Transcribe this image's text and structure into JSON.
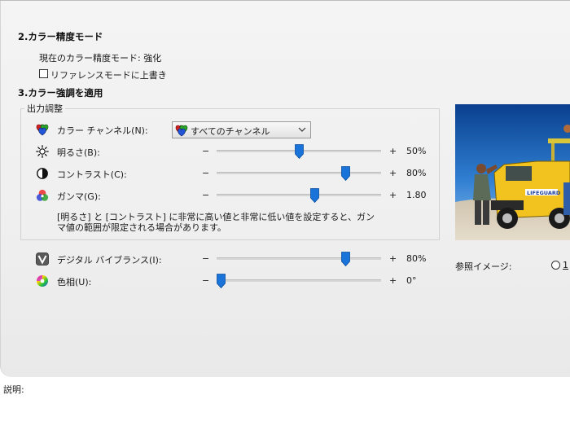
{
  "section2": {
    "heading": "2.カラー精度モード",
    "current_mode_label": "現在のカラー精度モード:",
    "current_mode_value": "強化",
    "override_checkbox_label": "リファレンスモードに上書き",
    "override_checked": false
  },
  "section3": {
    "heading": "3.カラー強調を適用",
    "group_title": "出力調整",
    "channel": {
      "label": "カラー チャンネル(N):",
      "selected": "すべてのチャンネル",
      "icon": "rgb-hearts-icon"
    },
    "sliders": [
      {
        "key": "brightness",
        "label": "明るさ(B):",
        "icon": "sun-icon",
        "minus": "−",
        "plus": "+",
        "value_text": "50%",
        "level": 0.5
      },
      {
        "key": "contrast",
        "label": "コントラスト(C):",
        "icon": "contrast-icon",
        "minus": "−",
        "plus": "+",
        "value_text": "80%",
        "level": 0.8
      },
      {
        "key": "gamma",
        "label": "ガンマ(G):",
        "icon": "gamma-icon",
        "minus": "−",
        "plus": "+",
        "value_text": "1.80",
        "level": 0.6
      }
    ],
    "note_line1": "[明るさ] と [コントラスト] に非常に高い値と非常に低い値を設定すると、ガン",
    "note_line2": "マ値の範囲が限定される場合があります。",
    "vibrance": {
      "label": "デジタル バイブランス(I):",
      "icon": "vibrance-icon",
      "minus": "−",
      "plus": "+",
      "value_text": "80%",
      "level": 0.8
    },
    "hue": {
      "label": "色相(U):",
      "icon": "hue-wheel-icon",
      "minus": "−",
      "plus": "+",
      "value_text": "0°",
      "level": 0.0
    }
  },
  "reference": {
    "label": "参照イメージ:",
    "radio_label": "1",
    "image_banner_text": "LIFEGUARD"
  },
  "footer": {
    "description_label": "説明:"
  },
  "colors": {
    "thumb": "#1a73d9",
    "track": "#d6d6d6"
  }
}
